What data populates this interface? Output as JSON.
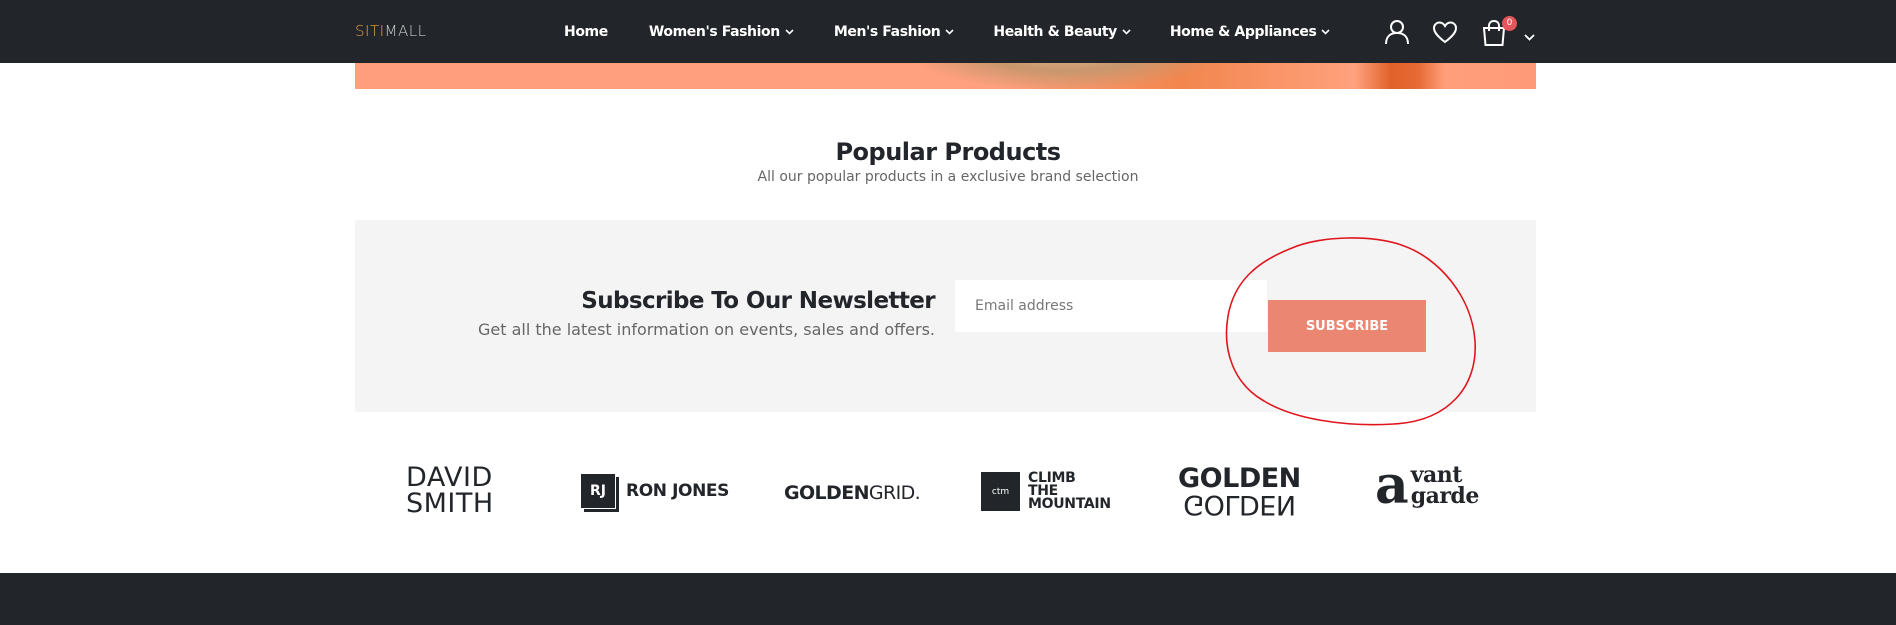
{
  "header": {
    "logo_part1": "SITI",
    "logo_part2": "MALL",
    "nav": [
      {
        "label": "Home"
      },
      {
        "label": "Women's Fashion"
      },
      {
        "label": "Men's Fashion"
      },
      {
        "label": "Health & Beauty"
      },
      {
        "label": "Home & Appliances"
      }
    ],
    "cart_count": "0",
    "icons": [
      "user-icon",
      "heart-icon",
      "cart-icon",
      "chevron-down-icon"
    ]
  },
  "popular": {
    "title": "Popular Products",
    "subtitle": "All our popular products in a exclusive brand selection"
  },
  "newsletter": {
    "title": "Subscribe To Our Newsletter",
    "text": "Get all the latest information on events, sales and offers.",
    "email_placeholder": "Email address",
    "button_label": "SUBSCRIBE"
  },
  "brands": {
    "david_line1": "DAVID",
    "david_line2": "SMITH",
    "rj_mark": "RJ",
    "rj_name": "RON JONES",
    "gg_bold": "GOLDEN",
    "gg_light": "GRID.",
    "ctm_mark": "ctm",
    "ctm_line1": "CLIMB",
    "ctm_line2": "THE",
    "ctm_line3": "MOUNTAIN",
    "golden_top": "GOLDEN",
    "golden_bottom": "GOLDEN",
    "av_a": "a",
    "av_line1": "vant",
    "av_line2": "garde"
  },
  "colors": {
    "topbar": "#222529",
    "accent_button": "#ea8672",
    "annotation_circle": "#e0161d",
    "logo_accent": "#e8a342",
    "cart_badge": "#e4555c"
  }
}
